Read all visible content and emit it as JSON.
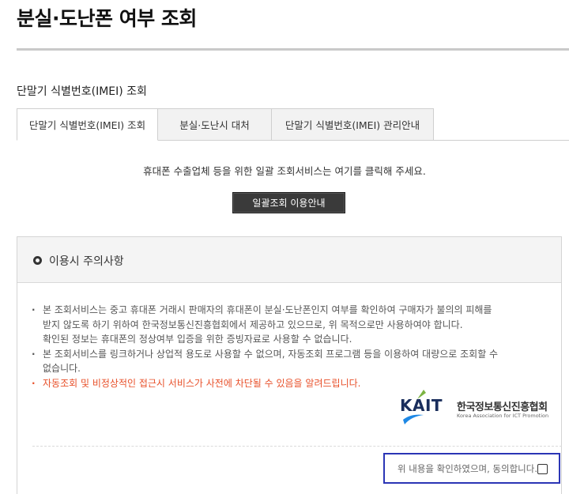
{
  "page": {
    "title": "분실·도난폰 여부 조회"
  },
  "section": {
    "title": "단말기 식별번호(IMEI) 조회"
  },
  "tabs": [
    {
      "label": "단말기 식별번호(IMEI) 조회",
      "active": true
    },
    {
      "label": "분실·도난시 대처",
      "active": false
    },
    {
      "label": "단말기 식별번호(IMEI) 관리안내",
      "active": false
    }
  ],
  "bulk": {
    "notice": "휴대폰 수출업체 등을 위한 일괄 조회서비스는 여기를 클릭해 주세요.",
    "button_label": "일괄조회 이용안내"
  },
  "notice": {
    "title": "이용시 주의사항",
    "items": [
      "본 조회서비스는 중고 휴대폰 거래시 판매자의 휴대폰이 분실·도난폰인지 여부를 확인하여 구매자가 불의의 피해를",
      "받지 않도록 하기 위하여 한국정보통신진흥협회에서 제공하고 있으므로, 위 목적으로만 사용하여야 합니다.",
      "확인된 정보는 휴대폰의 정상여부 입증을 위한 증빙자료로 사용할 수 없습니다.",
      "본 조회서비스를 링크하거나 상업적 용도로 사용할 수 없으며, 자동조회 프로그램 등을 이용하여 대량으로 조회할 수",
      "없습니다.",
      "자동조회 및 비정상적인 접근시 서비스가 사전에 차단될 수 있음을 알려드립니다."
    ],
    "warn_color": "#e8502a"
  },
  "logo": {
    "abbr": "KAIT",
    "name_kr": "한국정보통신진흥협회",
    "name_en": "Korea Association for ICT Promotion"
  },
  "agree": {
    "label": "위 내용을 확인하였으며, 동의합니다.",
    "checked": false,
    "highlight_color": "#2b35b5"
  }
}
